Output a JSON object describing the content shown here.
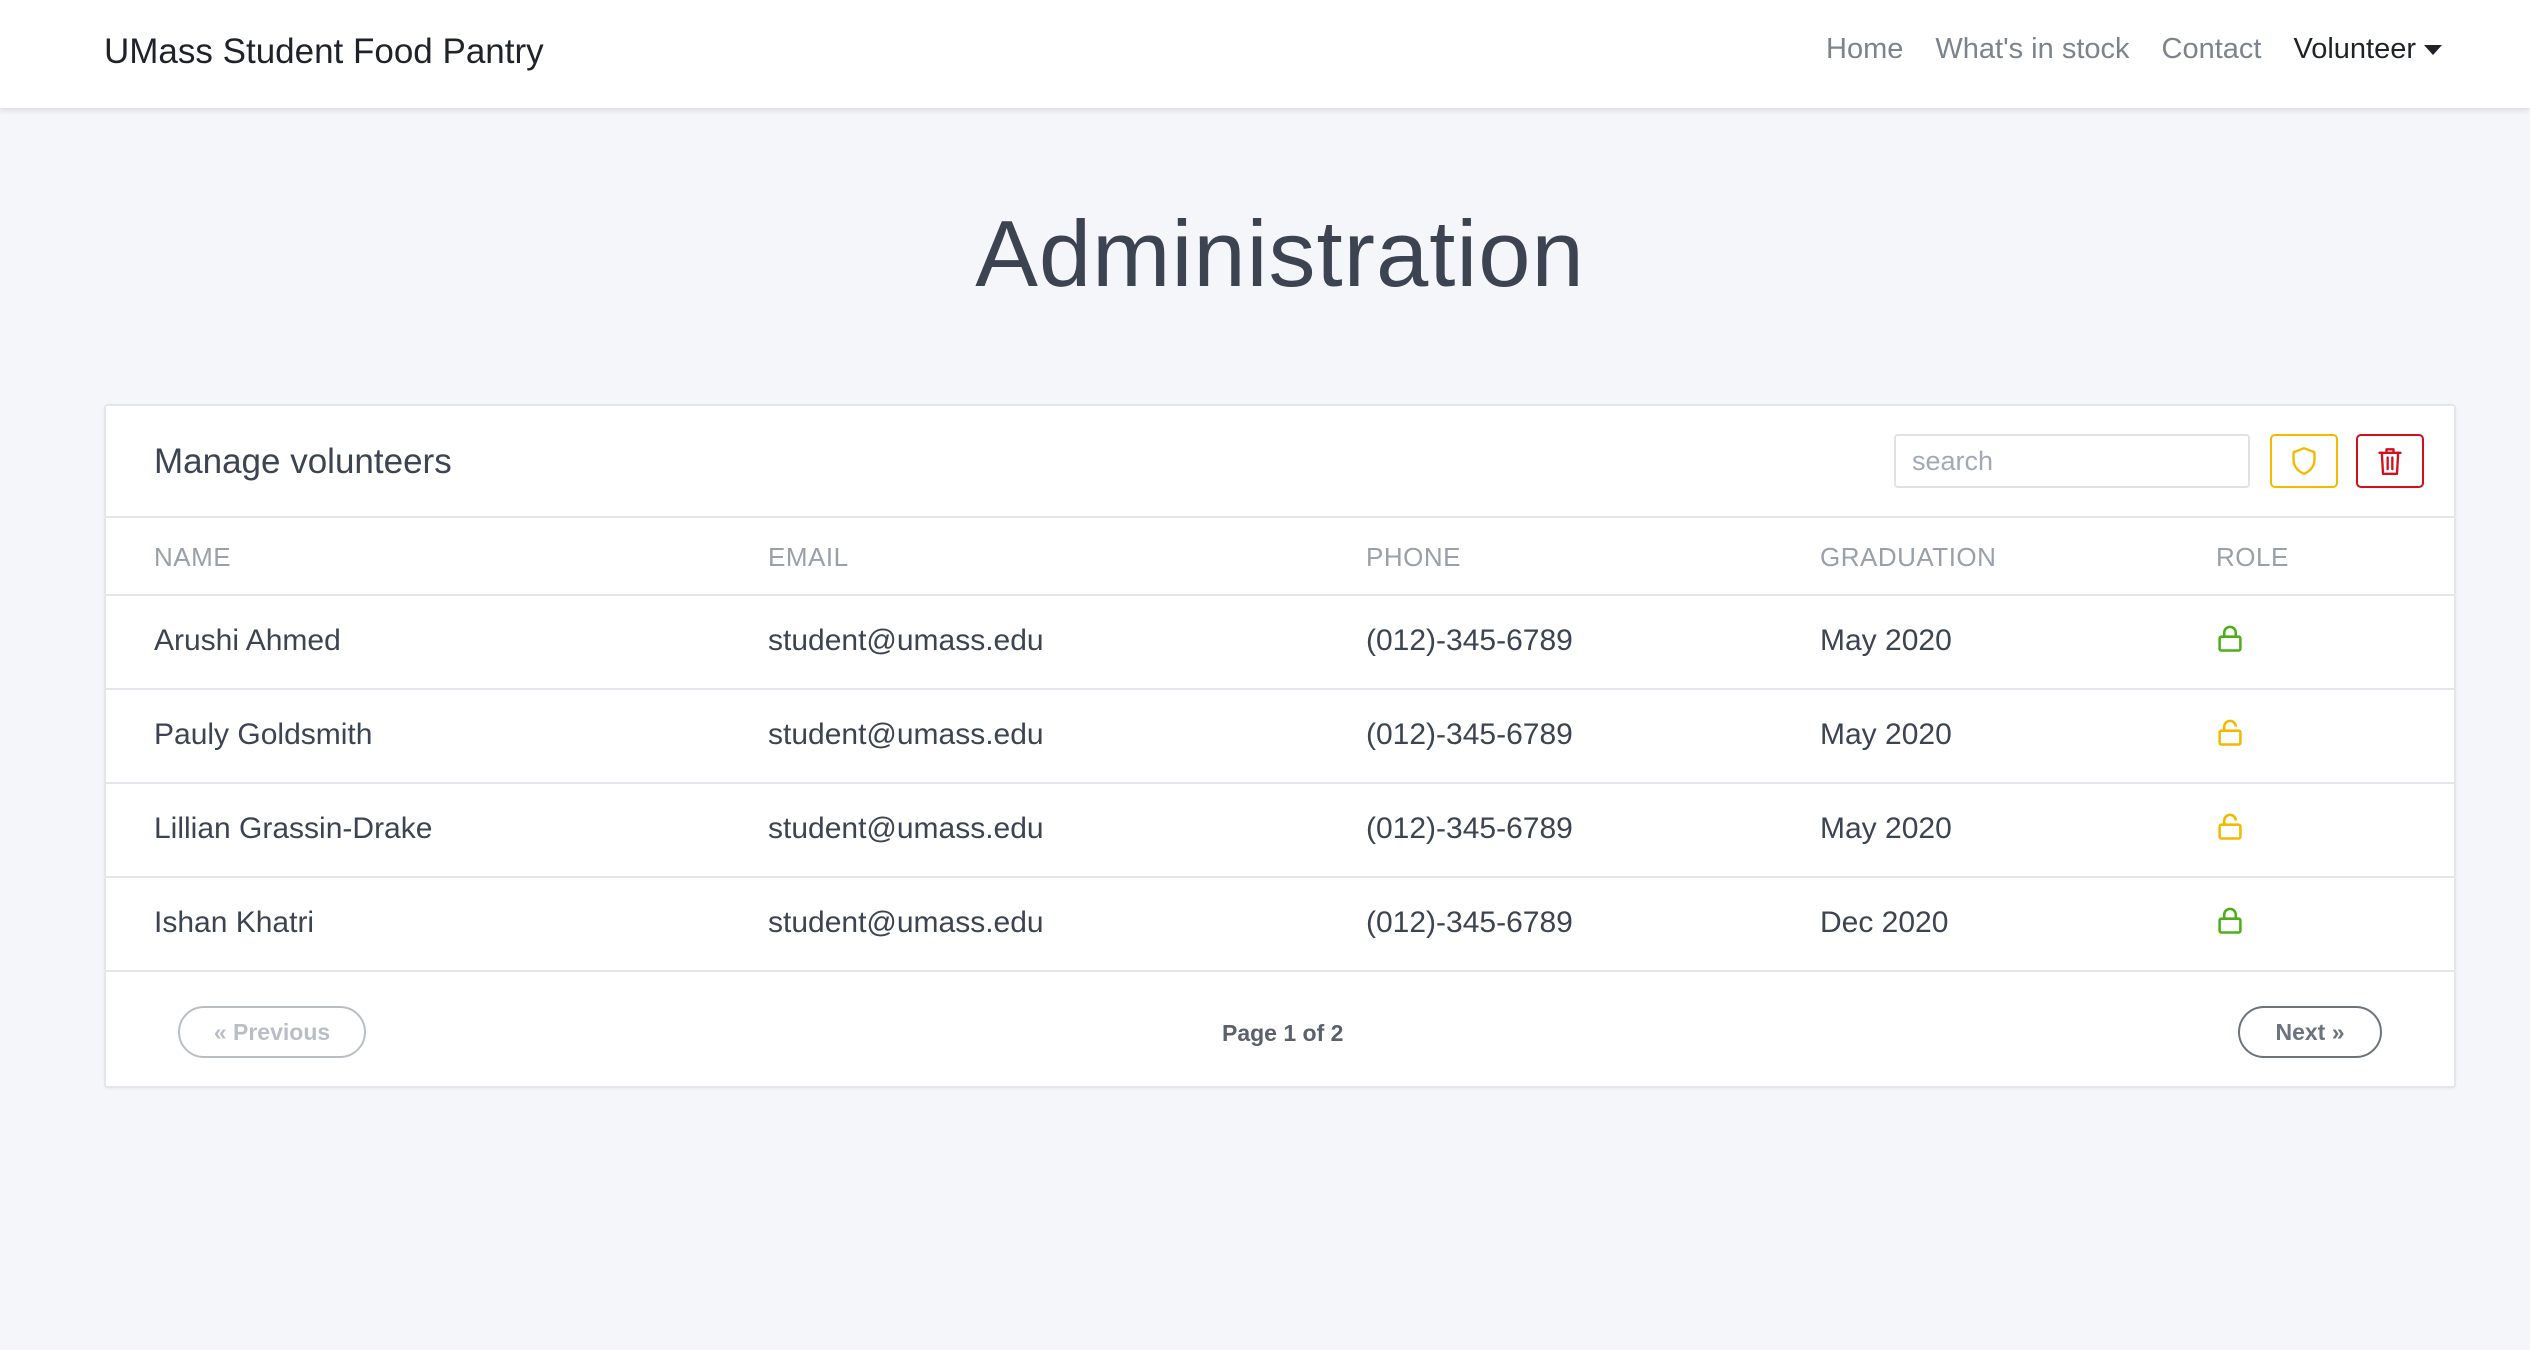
{
  "navbar": {
    "brand": "UMass Student Food Pantry",
    "links": [
      {
        "label": "Home"
      },
      {
        "label": "What's in stock"
      },
      {
        "label": "Contact"
      },
      {
        "label": "Volunteer"
      }
    ]
  },
  "page": {
    "title": "Administration"
  },
  "card": {
    "title": "Manage volunteers",
    "search": {
      "placeholder": "search",
      "value": ""
    },
    "columns": [
      "NAME",
      "EMAIL",
      "PHONE",
      "GRADUATION",
      "ROLE"
    ],
    "rows": [
      {
        "name": "Arushi Ahmed",
        "email": "student@umass.edu",
        "phone": "(012)-345-6789",
        "graduation": "May 2020",
        "role_icon": "lock-icon"
      },
      {
        "name": "Pauly Goldsmith",
        "email": "student@umass.edu",
        "phone": "(012)-345-6789",
        "graduation": "May 2020",
        "role_icon": "unlock-icon"
      },
      {
        "name": "Lillian Grassin-Drake",
        "email": "student@umass.edu",
        "phone": "(012)-345-6789",
        "graduation": "May 2020",
        "role_icon": "unlock-icon"
      },
      {
        "name": "Ishan Khatri",
        "email": "student@umass.edu",
        "phone": "(012)-345-6789",
        "graduation": "Dec 2020",
        "role_icon": "lock-icon"
      }
    ],
    "pagination": {
      "previous_label": "« Previous",
      "page_info": "Page 1 of 2",
      "next_label": "Next »"
    }
  },
  "colors": {
    "lock": "#4caf1a",
    "unlock": "#f5b800",
    "shield": "#f5b800",
    "trash": "#d0101b"
  }
}
